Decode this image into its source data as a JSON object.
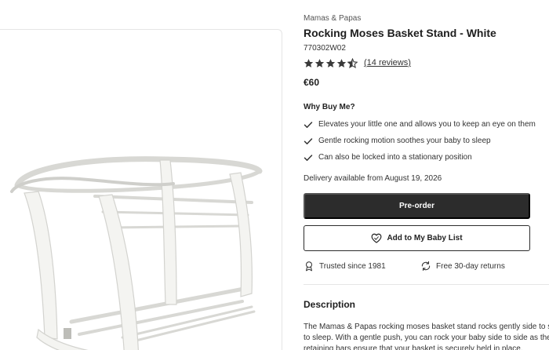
{
  "product": {
    "brand": "Mamas & Papas",
    "title": "Rocking Moses Basket Stand - White",
    "sku": "770302W02",
    "rating": 4.5,
    "rating_max": 5,
    "reviews_link": "(14 reviews)",
    "price": "€60",
    "image_label": "770302W02"
  },
  "why_buy": {
    "heading": "Why Buy Me?",
    "items": [
      {
        "text": "Elevates your little one and allows you to keep an eye on them",
        "icon": "check-icon"
      },
      {
        "text": "Gentle rocking motion soothes your baby to sleep",
        "icon": "check-icon"
      },
      {
        "text": "Can also be locked into a stationary position",
        "icon": "check-icon"
      }
    ]
  },
  "delivery": "Delivery available from August 19, 2026",
  "actions": {
    "preorder_label": "Pre-order",
    "baby_list_label": "Add to My Baby List",
    "baby_list_icon": "heart-icon"
  },
  "perks": {
    "trusted": {
      "label": "Trusted since 1981",
      "icon": "award-icon"
    },
    "returns": {
      "label": "Free 30-day returns",
      "icon": "returns-icon"
    }
  },
  "description": {
    "heading": "Description",
    "lines": [
      "The Mamas & Papas rocking moses basket stand rocks gently side to side",
      "to sleep. With a gentle push, you can rock your baby side to side as the",
      "retaining bars ensure that your basket is securely held in place."
    ]
  },
  "colors": {
    "primary_button": "#2c2c2c",
    "text": "#222222",
    "star": "#3a3a3a",
    "border": "#e5e5e5"
  }
}
